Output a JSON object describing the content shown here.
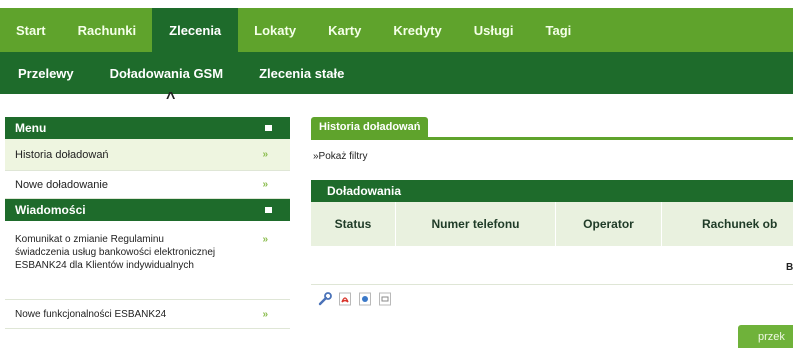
{
  "top_nav": {
    "items": [
      "Start",
      "Rachunki",
      "Zlecenia",
      "Lokaty",
      "Karty",
      "Kredyty",
      "Usługi",
      "Tagi"
    ],
    "active": "Zlecenia"
  },
  "sub_nav": {
    "items": [
      "Przelewy",
      "Doładowania GSM",
      "Zlecenia stałe"
    ],
    "active": "Doładowania GSM"
  },
  "sidebar": {
    "menu_header": "Menu",
    "menu_items": [
      "Historia doładowań",
      "Nowe doładowanie"
    ],
    "messages_header": "Wiadomości",
    "messages": [
      "Komunikat o zmianie Regulaminu świadczenia usług bankowości elektronicznej ESBANK24 dla Klientów indywidualnych",
      "Nowe funkcjonalności ESBANK24"
    ],
    "arrow_glyph": "»"
  },
  "main": {
    "tab_label": "Historia doładowań",
    "show_filters": "»Pokaż filtry",
    "table_title": "Doładowania",
    "columns": [
      "Status",
      "Numer telefonu",
      "Operator",
      "Rachunek ob"
    ],
    "empty_cell": "B",
    "next_button": "przek"
  },
  "export_icons": [
    "wrench-icon",
    "pdf-icon",
    "csv-icon",
    "print-icon"
  ],
  "colors": {
    "nav_green": "#5fa32c",
    "dark_green": "#1e6b2b",
    "light_green": "#e9f1df"
  }
}
